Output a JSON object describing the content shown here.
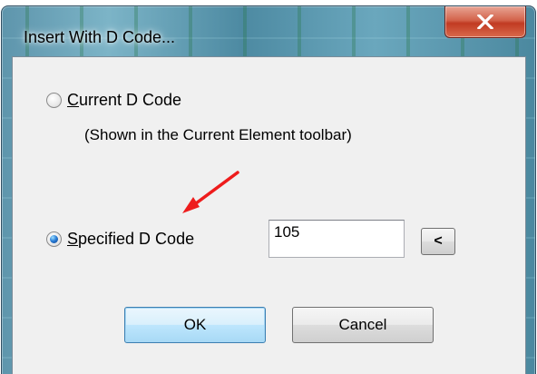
{
  "window": {
    "title": "Insert With D Code..."
  },
  "options": {
    "current": {
      "label_underlined": "C",
      "label_rest": "urrent D Code",
      "selected": false
    },
    "note": "(Shown in the Current Element toolbar)",
    "specified": {
      "label_underlined": "S",
      "label_rest": "pecified D Code",
      "selected": true
    }
  },
  "d_code_input": {
    "value": "105"
  },
  "pick_button": {
    "label": "<"
  },
  "buttons": {
    "ok": "OK",
    "cancel": "Cancel"
  },
  "colors": {
    "annotation_arrow": "#ee1c1c",
    "close_button": "#c7452b"
  },
  "icons": {
    "close": "close-icon",
    "annotation": "red-arrow"
  }
}
